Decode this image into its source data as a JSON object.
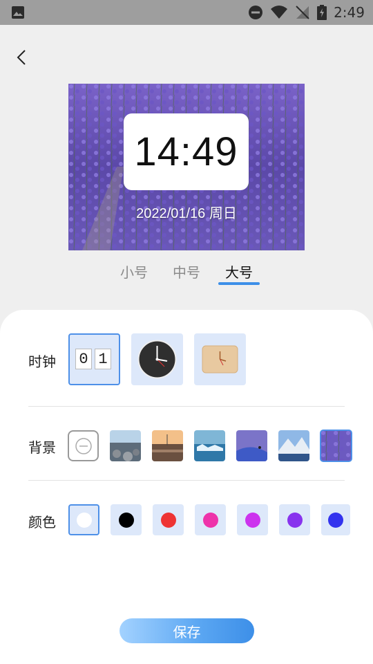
{
  "status_bar": {
    "time": "2:49"
  },
  "preview": {
    "time": "14:49",
    "date": "2022/01/16 周日"
  },
  "size_tabs": [
    {
      "label": "小号"
    },
    {
      "label": "中号"
    },
    {
      "label": "大号"
    }
  ],
  "size_tabs_selected": "大号",
  "settings": {
    "clock_label": "时钟",
    "background_label": "背景",
    "color_label": "颜色",
    "flip_digits": [
      "0",
      "1"
    ]
  },
  "clock_styles": [
    "flip-clock",
    "analog-dark",
    "analog-wood"
  ],
  "clock_style_selected": "flip-clock",
  "backgrounds": [
    "none",
    "rocky-beach",
    "sunset-pier",
    "ice-sea",
    "purple-snowfield",
    "snowy-mountain-lake",
    "lavender-field"
  ],
  "background_selected": "lavender-field",
  "colors": [
    "#ffffff",
    "#000000",
    "#ee3333",
    "#ee33aa",
    "#cc33ee",
    "#8833ee",
    "#3333ee"
  ],
  "color_selected": "#ffffff",
  "save_button": {
    "label": "保存"
  }
}
